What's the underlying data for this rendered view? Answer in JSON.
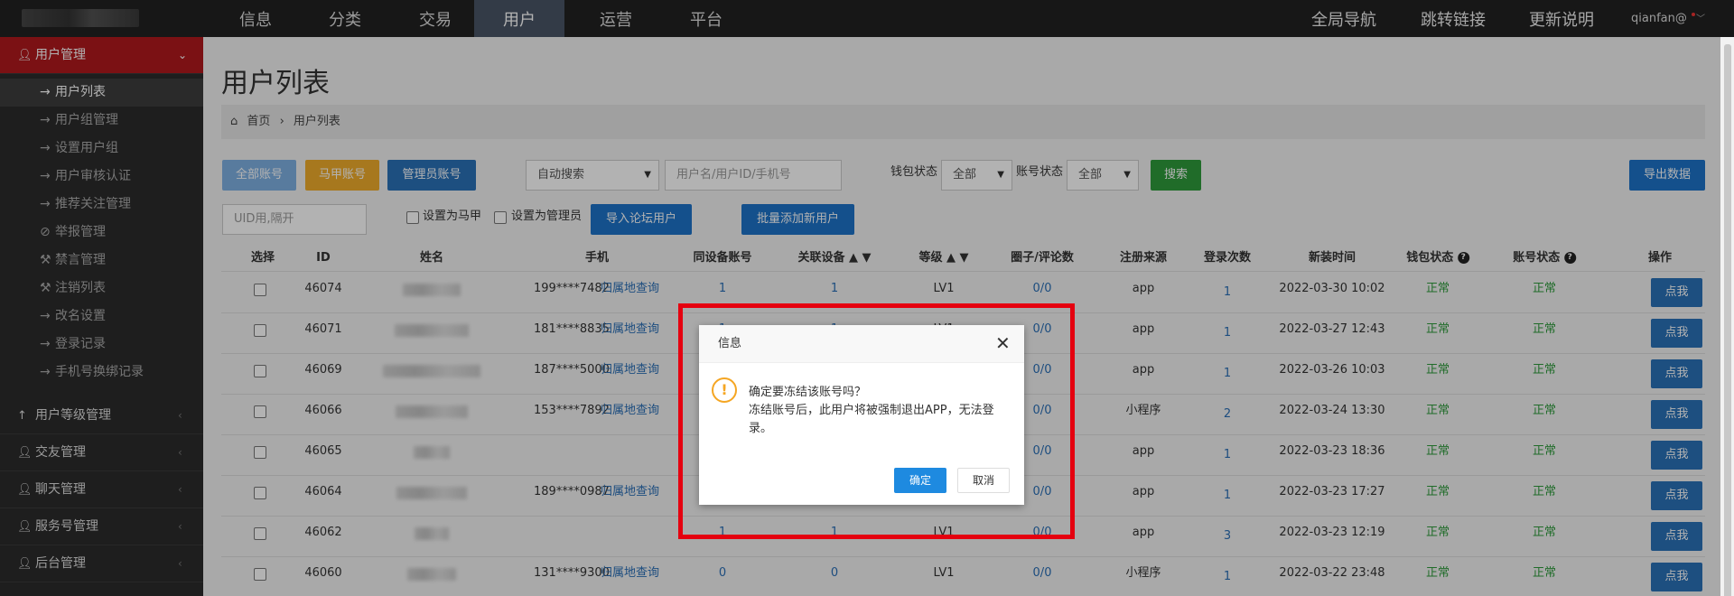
{
  "topnav": {
    "items": [
      "信息",
      "分类",
      "交易",
      "用户",
      "运营",
      "平台"
    ],
    "active": "用户",
    "right": [
      "全局导航",
      "跳转链接",
      "更新说明"
    ],
    "user": "qianfan@"
  },
  "sidebar": {
    "open_section": "用户管理",
    "sub_items": [
      {
        "icon": "→",
        "label": "用户列表",
        "active": true
      },
      {
        "icon": "→",
        "label": "用户组管理"
      },
      {
        "icon": "→",
        "label": "设置用户组"
      },
      {
        "icon": "→",
        "label": "用户审核认证"
      },
      {
        "icon": "→",
        "label": "推荐关注管理"
      },
      {
        "icon": "⊘",
        "label": "举报管理"
      },
      {
        "icon": "⚒",
        "label": "禁言管理"
      },
      {
        "icon": "⚒",
        "label": "注销列表"
      },
      {
        "icon": "→",
        "label": "改名设置"
      },
      {
        "icon": "→",
        "label": "登录记录"
      },
      {
        "icon": "→",
        "label": "手机号换绑记录"
      }
    ],
    "sections": [
      "用户等级管理",
      "交友管理",
      "聊天管理",
      "服务号管理",
      "后台管理"
    ]
  },
  "page": {
    "title": "用户列表",
    "breadcrumb": [
      "首页",
      "用户列表"
    ]
  },
  "toolbar": {
    "all_accounts": "全部账号",
    "vest_accounts": "马甲账号",
    "admin_accounts": "管理员账号",
    "search_mode": "自动搜索",
    "search_placeholder": "用户名/用户ID/手机号",
    "wallet_status_label": "钱包状态",
    "wallet_status_value": "全部",
    "account_status_label": "账号状态",
    "account_status_value": "全部",
    "search_button": "搜索",
    "export_button": "导出数据",
    "uid_placeholder": "UID用,隔开",
    "set_vest": "设置为马甲",
    "set_admin": "设置为管理员",
    "import_forum": "导入论坛用户",
    "batch_add": "批量添加新用户"
  },
  "table": {
    "headers": [
      "选择",
      "ID",
      "姓名",
      "手机",
      "同设备账号",
      "关联设备 ▲ ▼",
      "等级 ▲ ▼",
      "圈子/评论数",
      "注册来源",
      "登录次数",
      "新装时间",
      "钱包状态",
      "账号状态",
      "操作"
    ],
    "geo_link": "归属地查询",
    "rows": [
      {
        "id": "46074",
        "phone": "199****7482",
        "same": "1",
        "assoc": "1",
        "level": "LV1",
        "circle": "0/0",
        "source": "app",
        "logins": "1",
        "time": "2022-03-30 10:02",
        "wallet": "正常",
        "account": "正常",
        "action": "点我"
      },
      {
        "id": "46071",
        "phone": "181****8835",
        "same": "1",
        "assoc": "1",
        "level": "LV1",
        "circle": "0/0",
        "source": "app",
        "logins": "1",
        "time": "2022-03-27 12:43",
        "wallet": "正常",
        "account": "正常",
        "action": "点我"
      },
      {
        "id": "46069",
        "phone": "187****5000",
        "same": "",
        "assoc": "",
        "level": "",
        "circle": "0/0",
        "source": "app",
        "logins": "1",
        "time": "2022-03-26 10:03",
        "wallet": "正常",
        "account": "正常",
        "action": "点我"
      },
      {
        "id": "46066",
        "phone": "153****7892",
        "same": "",
        "assoc": "",
        "level": "",
        "circle": "0/0",
        "source": "小程序",
        "logins": "2",
        "time": "2022-03-24 13:30",
        "wallet": "正常",
        "account": "正常",
        "action": "点我"
      },
      {
        "id": "46065",
        "phone": "",
        "same": "",
        "assoc": "",
        "level": "",
        "circle": "0/0",
        "source": "app",
        "logins": "1",
        "time": "2022-03-23 18:36",
        "wallet": "正常",
        "account": "正常",
        "action": "点我"
      },
      {
        "id": "46064",
        "phone": "189****0987",
        "same": "",
        "assoc": "",
        "level": "",
        "circle": "0/0",
        "source": "app",
        "logins": "1",
        "time": "2022-03-23 17:27",
        "wallet": "正常",
        "account": "正常",
        "action": "点我"
      },
      {
        "id": "46062",
        "phone": "",
        "same": "1",
        "assoc": "1",
        "level": "LV1",
        "circle": "0/0",
        "source": "app",
        "logins": "3",
        "time": "2022-03-23 12:19",
        "wallet": "正常",
        "account": "正常",
        "action": "点我"
      },
      {
        "id": "46060",
        "phone": "131****9300",
        "same": "0",
        "assoc": "0",
        "level": "LV1",
        "circle": "0/0",
        "source": "小程序",
        "logins": "1",
        "time": "2022-03-22 23:48",
        "wallet": "正常",
        "account": "正常",
        "action": "点我"
      }
    ]
  },
  "dialog": {
    "title": "信息",
    "line1": "确定要冻结该账号吗？",
    "line2": "冻结账号后，此用户将被强制退出APP，无法登录。",
    "confirm": "确定",
    "cancel": "取消"
  },
  "colors": {
    "sidebar_active": "#b0191e",
    "topbar": "#222222",
    "highlight": "#e5000f"
  }
}
